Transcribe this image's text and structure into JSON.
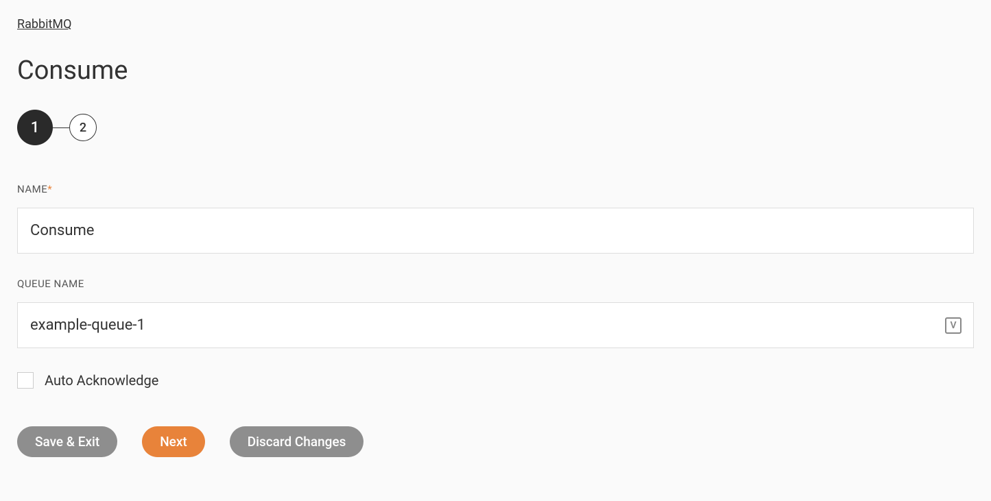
{
  "breadcrumb": {
    "label": "RabbitMQ"
  },
  "page": {
    "title": "Consume"
  },
  "stepper": {
    "steps": [
      "1",
      "2"
    ],
    "active_index": 0
  },
  "form": {
    "name": {
      "label": "NAME",
      "required": true,
      "value": "Consume"
    },
    "queue_name": {
      "label": "QUEUE NAME",
      "required": false,
      "value": "example-queue-1",
      "variable_icon_text": "V"
    },
    "auto_ack": {
      "label": "Auto Acknowledge",
      "checked": false
    }
  },
  "buttons": {
    "save_exit": "Save & Exit",
    "next": "Next",
    "discard": "Discard Changes"
  }
}
